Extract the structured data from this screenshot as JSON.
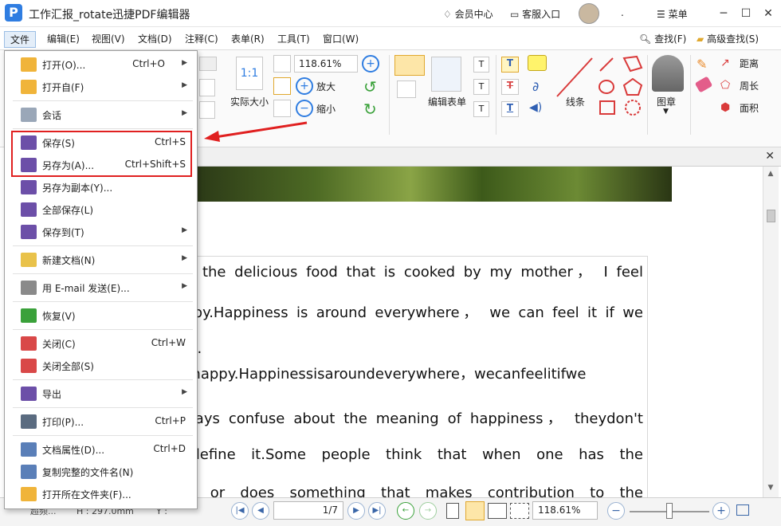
{
  "window": {
    "title": "工作汇报_rotate迅捷PDF编辑器",
    "member_center": "会员中心",
    "customer_service": "客服入口",
    "dot": ".",
    "menu_label": "菜单",
    "minimize": "─",
    "restore": "☐",
    "close": "✕"
  },
  "menubar": [
    "文件",
    "编辑(E)",
    "视图(V)",
    "文档(D)",
    "注释(C)",
    "表单(R)",
    "工具(T)",
    "窗口(W)"
  ],
  "search": {
    "find": "查找(F)",
    "advanced": "高级查找(S)"
  },
  "toolbar": {
    "actual_size": "实际大小",
    "actual_size_glyph": "1:1",
    "zoom_value": "118.61%",
    "zoom_in": "放大",
    "zoom_out": "缩小",
    "edit_form": "编辑表单",
    "line": "线条",
    "stamp": "图章",
    "distance": "距离",
    "perimeter": "周长",
    "area": "面积"
  },
  "file_menu": [
    {
      "label": "打开(O)...",
      "shortcut": "Ctrl+O",
      "submenu": true,
      "color": "#f0b43a"
    },
    {
      "label": "打开自(F)",
      "shortcut": "",
      "submenu": true,
      "color": "#f0b43a"
    },
    {
      "label": "会话",
      "shortcut": "",
      "submenu": true,
      "color": "#9aa7b8"
    },
    {
      "label": "保存(S)",
      "shortcut": "Ctrl+S",
      "submenu": false,
      "color": "#6c4fa8"
    },
    {
      "label": "另存为(A)...",
      "shortcut": "Ctrl+Shift+S",
      "submenu": false,
      "color": "#6c4fa8"
    },
    {
      "label": "另存为副本(Y)...",
      "shortcut": "",
      "submenu": false,
      "color": "#6c4fa8"
    },
    {
      "label": "全部保存(L)",
      "shortcut": "",
      "submenu": false,
      "color": "#6c4fa8"
    },
    {
      "label": "保存到(T)",
      "shortcut": "",
      "submenu": true,
      "color": "#6c4fa8"
    },
    {
      "label": "新建文档(N)",
      "shortcut": "",
      "submenu": true,
      "color": "#e9c24a"
    },
    {
      "label": "用 E-mail 发送(E)...",
      "shortcut": "",
      "submenu": true,
      "color": "#8a8a8a"
    },
    {
      "label": "恢复(V)",
      "shortcut": "",
      "submenu": false,
      "color": "#3aa13a"
    },
    {
      "label": "关闭(C)",
      "shortcut": "Ctrl+W",
      "submenu": false,
      "color": "#d94848"
    },
    {
      "label": "关闭全部(S)",
      "shortcut": "",
      "submenu": false,
      "color": "#d94848"
    },
    {
      "label": "导出",
      "shortcut": "",
      "submenu": true,
      "color": "#6c4fa8"
    },
    {
      "label": "打印(P)...",
      "shortcut": "Ctrl+P",
      "submenu": false,
      "color": "#5a6b80"
    },
    {
      "label": "文档属性(D)...",
      "shortcut": "Ctrl+D",
      "submenu": false,
      "color": "#5a7fb8"
    },
    {
      "label": "复制完整的文件名(N)",
      "shortcut": "",
      "submenu": false,
      "color": "#5a7fb8"
    },
    {
      "label": "打开所在文件夹(F)...",
      "shortcut": "",
      "submenu": false,
      "color": "#f0b43a"
    }
  ],
  "document": {
    "lines": [
      "n leat the delicious food that is cooked by my mother， I feel",
      "d happy.Happiness is around everywhere， we can feel it if we",
      "ht.",
      "dhappy.Happinessisaroundeverywhere，wecanfeelitifwe",
      "t.",
      "le always confuse about the meaning of happiness， theydon't",
      "wto define it.Some people think that when one has the",
      "career or does something that makes contribution to the"
    ]
  },
  "statusbar": {
    "left_text": "超频...",
    "height_label": "H : 297.0mm",
    "y_label": "Y :",
    "page_input": "1/7",
    "zoom_value": "118.61%"
  },
  "colors": {
    "accent": "#2f7de1",
    "highlight": "#e02020"
  }
}
